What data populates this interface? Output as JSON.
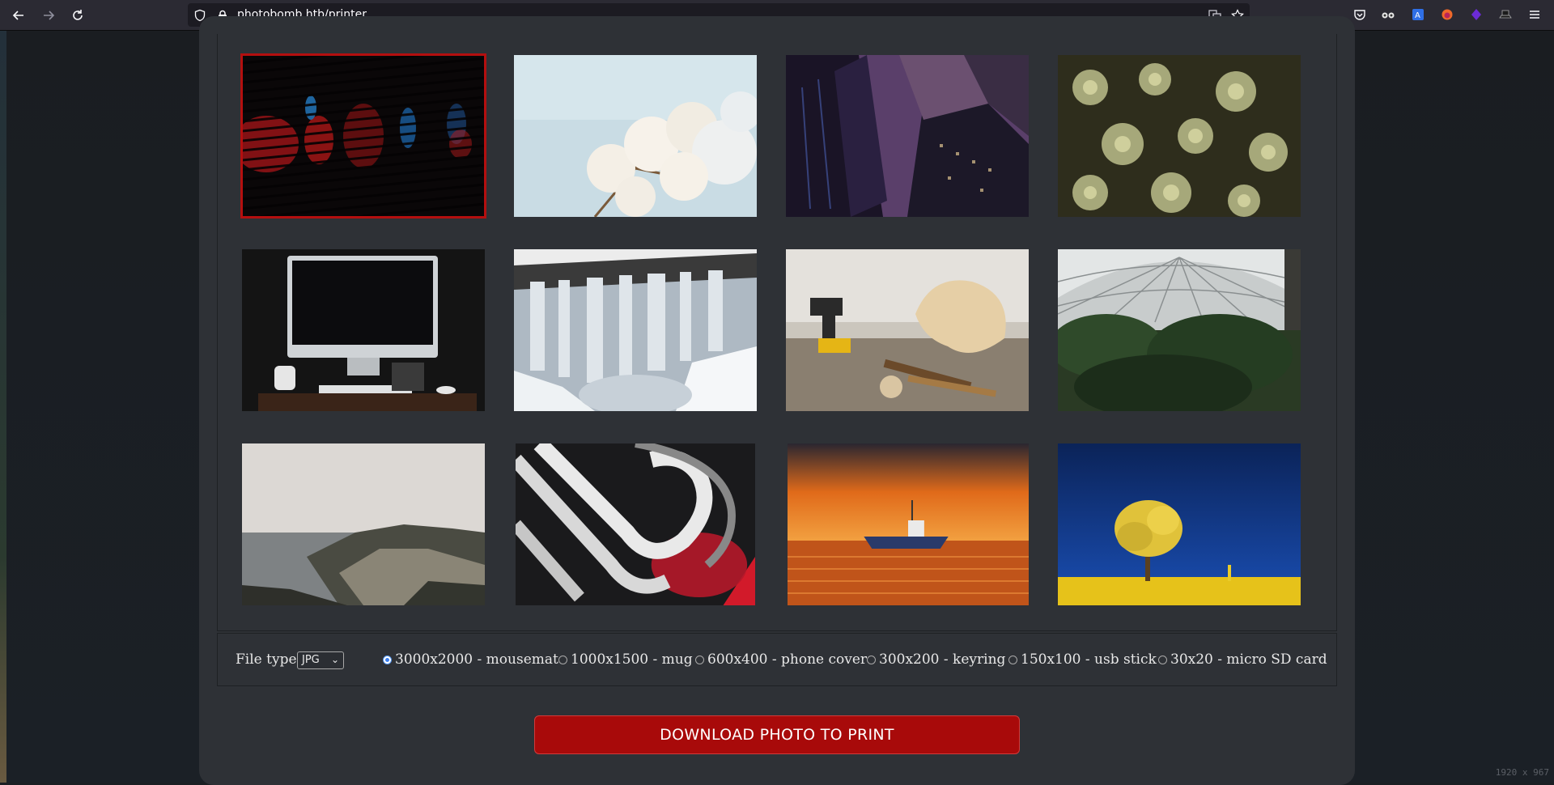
{
  "browser": {
    "url": "photobomb.htb/printer",
    "icons": [
      "back-icon",
      "forward-icon",
      "reload-icon",
      "shield-icon",
      "lock-icon",
      "translate-icon",
      "star-icon",
      "pocket-icon",
      "extension-icons",
      "menu-icon"
    ]
  },
  "gallery": {
    "photos": [
      {
        "subject": "red neon blinds",
        "selected": true
      },
      {
        "subject": "white magnolia blossoms"
      },
      {
        "subject": "skyscrapers looking up"
      },
      {
        "subject": "succulent leaves"
      },
      {
        "subject": "desktop computer on desk"
      },
      {
        "subject": "frozen waterfall"
      },
      {
        "subject": "woodworking tools and guitar body"
      },
      {
        "subject": "greenhouse interior"
      },
      {
        "subject": "misty coastline"
      },
      {
        "subject": "abstract chrome and red"
      },
      {
        "subject": "boat at sunset"
      },
      {
        "subject": "yellow tree under blue sky"
      }
    ]
  },
  "options": {
    "file_type_label": "File type",
    "file_type_value": "JPG",
    "sizes": [
      {
        "label": "3000x2000 - mousemat",
        "checked": true
      },
      {
        "label": "1000x1500 - mug",
        "checked": false
      },
      {
        "label": "600x400 - phone cover",
        "checked": false
      },
      {
        "label": "300x200 - keyring",
        "checked": false
      },
      {
        "label": "150x100 - usb stick",
        "checked": false
      },
      {
        "label": "30x20 - micro SD card",
        "checked": false
      }
    ]
  },
  "download_button": "DOWNLOAD PHOTO TO PRINT",
  "screen_dims": "1920 x 967",
  "colors": {
    "accent": "#a80a0a",
    "panel": "#2e3136",
    "selected_border": "#b40f0f"
  }
}
